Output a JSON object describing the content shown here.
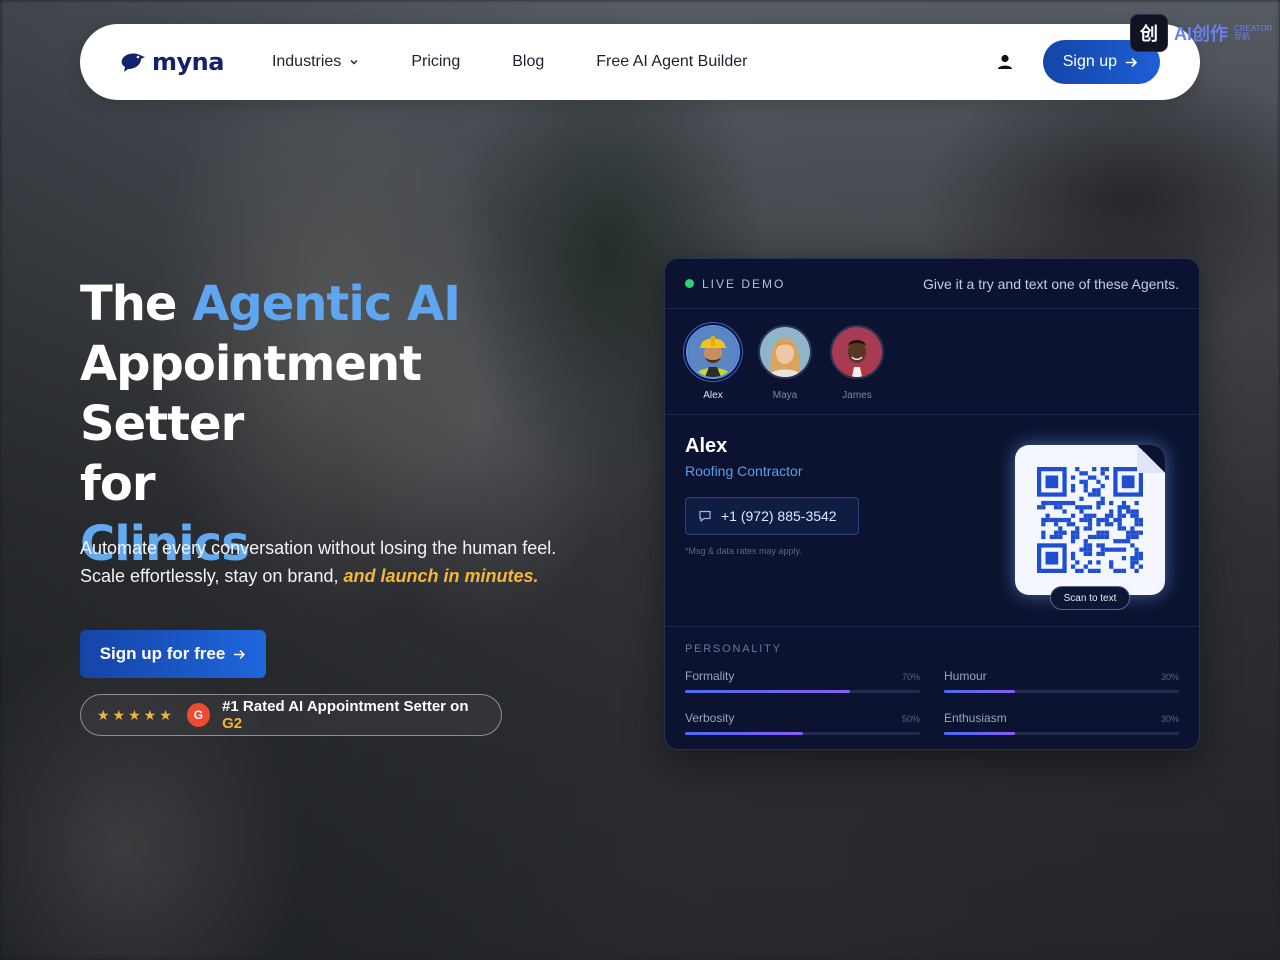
{
  "nav": {
    "logo_text": "myna",
    "links": [
      {
        "label": "Industries",
        "has_dropdown": true
      },
      {
        "label": "Pricing"
      },
      {
        "label": "Blog"
      },
      {
        "label": "Free AI Agent Builder"
      }
    ],
    "account_icon": "user-icon",
    "signup_label": "Sign up"
  },
  "watermark": {
    "badge": "创",
    "text": "AI创作",
    "sub_top": "CREATOR",
    "sub_bottom": "导航"
  },
  "hero": {
    "title_1": "The",
    "title_accent": "Agentic AI",
    "title_2": "Appointment Setter",
    "title_3": "for",
    "title_industry": "Clinics",
    "subtitle_1": "Automate every conversation without losing the human feel.",
    "subtitle_2": "Scale effortlessly, stay on brand,",
    "subtitle_highlight": "and launch in minutes.",
    "cta_label": "Sign up for free",
    "rating_stars": "★★★★★",
    "g2_badge": "G",
    "rating_text": "#1 Rated AI Appointment Setter on",
    "rating_platform": "G2"
  },
  "demo": {
    "live_label": "LIVE DEMO",
    "hint": "Give it a try and text one of these Agents.",
    "agents": [
      {
        "name": "Alex",
        "active": true
      },
      {
        "name": "Maya",
        "active": false
      },
      {
        "name": "James",
        "active": false
      }
    ],
    "selected": {
      "name": "Alex",
      "role": "Roofing Contractor",
      "phone": "+1 (972) 885-3542",
      "disclaimer": "*Msg & data rates may apply.",
      "scan_label": "Scan to text"
    },
    "personality": {
      "title": "PERSONALITY",
      "traits": [
        {
          "name": "Formality",
          "value_label": "70%",
          "value": 0.7
        },
        {
          "name": "Humour",
          "value_label": "30%",
          "value": 0.3
        },
        {
          "name": "Verbosity",
          "value_label": "50%",
          "value": 0.5
        },
        {
          "name": "Enthusiasm",
          "value_label": "30%",
          "value": 0.3
        }
      ]
    }
  },
  "colors": {
    "brand_navy": "#14226b",
    "accent_blue": "#5ea6ef",
    "highlight_gold": "#f5b63a",
    "card_bg": "#0b1330"
  }
}
